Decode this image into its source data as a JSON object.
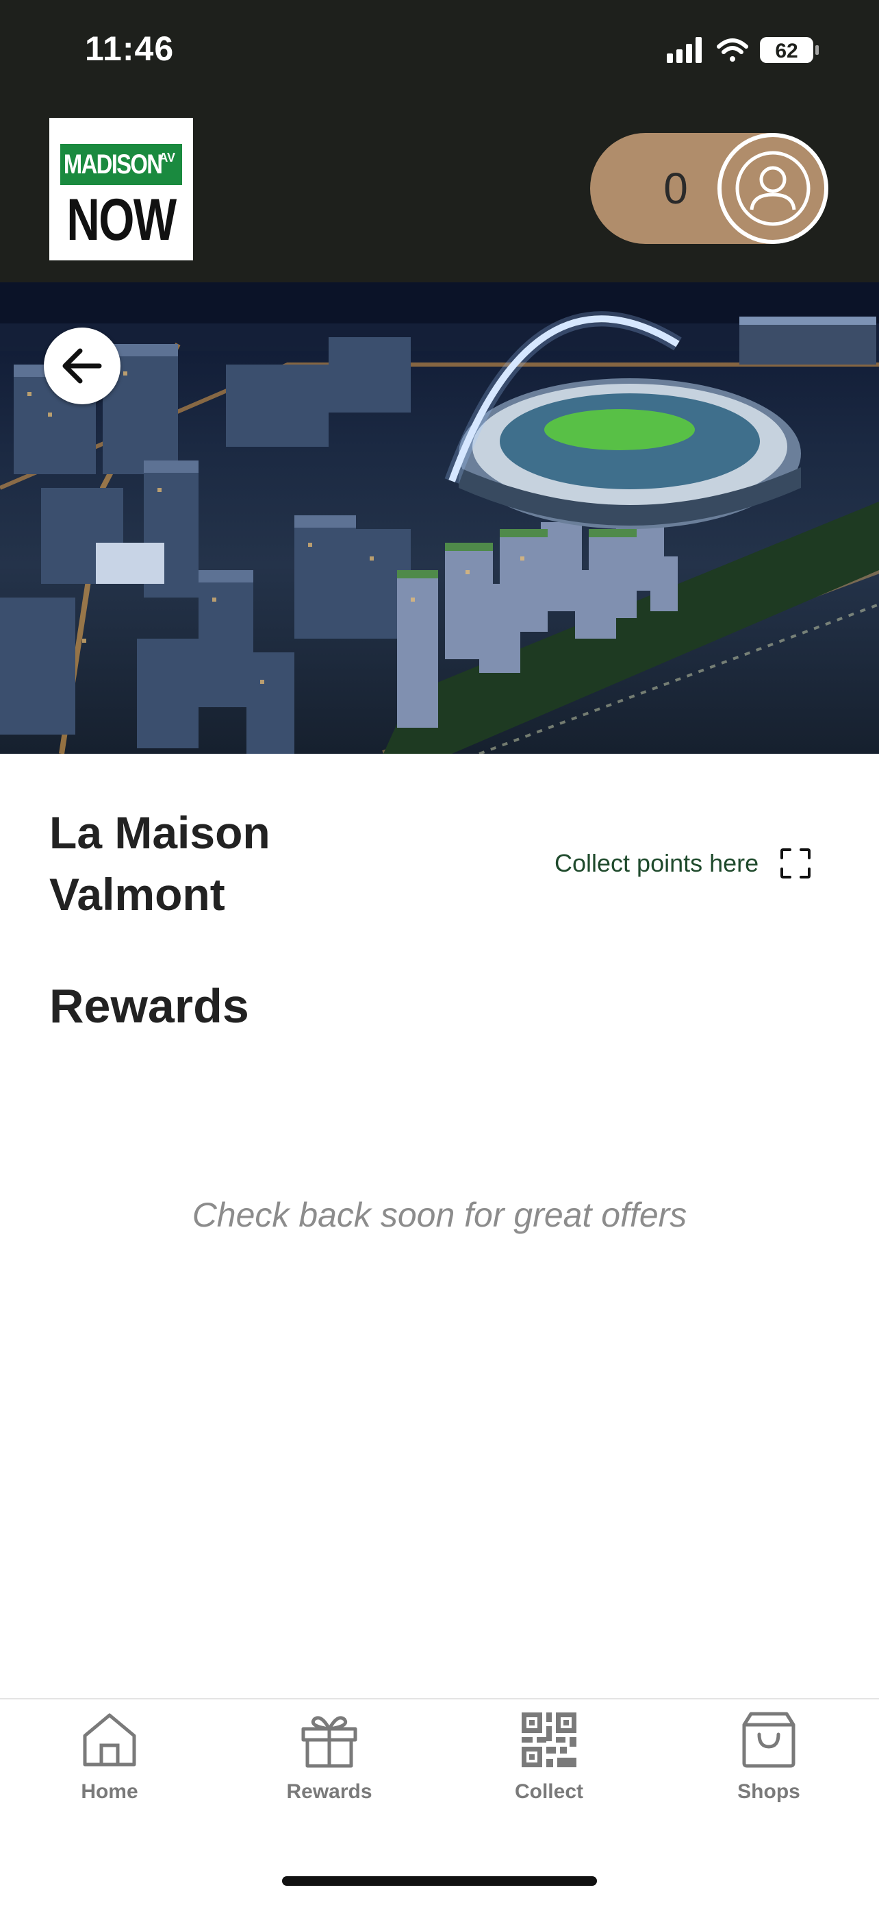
{
  "status_bar": {
    "time": "11:46",
    "battery": "62"
  },
  "header": {
    "logo": {
      "line1": "MADISON",
      "suffix": "AV",
      "line2": "NOW"
    },
    "points": "0"
  },
  "store": {
    "name": "La Maison Valmont",
    "collect_label": "Collect points here"
  },
  "rewards": {
    "heading": "Rewards",
    "empty_message": "Check back soon for great offers"
  },
  "nav": {
    "items": [
      {
        "label": "Home",
        "icon": "home-icon"
      },
      {
        "label": "Rewards",
        "icon": "gift-icon"
      },
      {
        "label": "Collect",
        "icon": "qr-code-icon"
      },
      {
        "label": "Shops",
        "icon": "shopping-bag-icon"
      }
    ]
  },
  "colors": {
    "header_bg": "#1e201c",
    "accent": "#b08d6b",
    "link_green": "#1f4a2c",
    "logo_green": "#1a8a3f",
    "muted_text": "#8c8c8c"
  }
}
